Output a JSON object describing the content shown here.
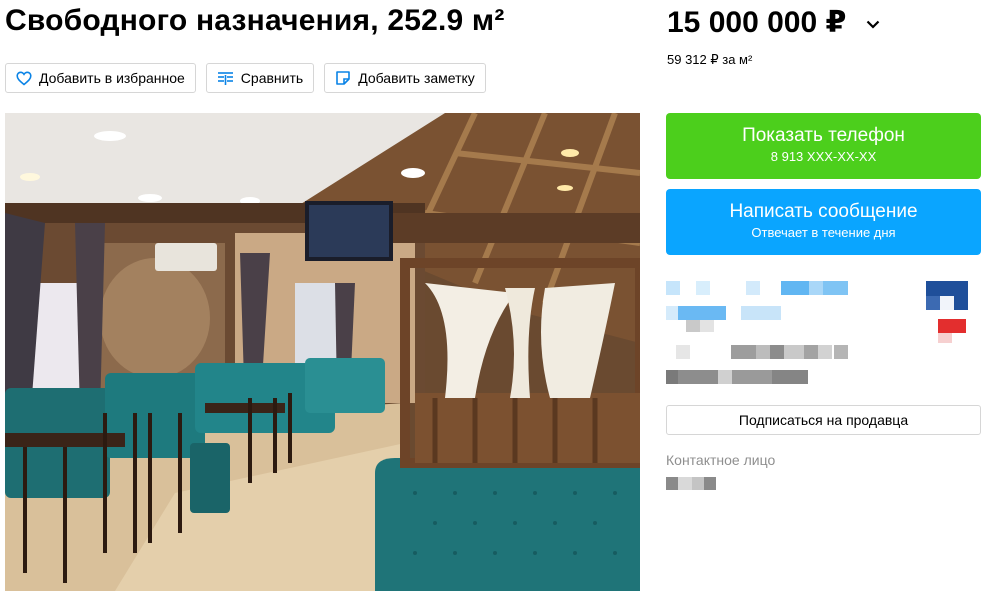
{
  "listing": {
    "title": "Свободного назначения, 252.9 м²",
    "price": "15 000 000 ₽",
    "price_per_m": "59 312 ₽ за м²"
  },
  "actions": {
    "favorite": "Добавить в избранное",
    "compare": "Сравнить",
    "note": "Добавить заметку"
  },
  "contact": {
    "phone_title": "Показать телефон",
    "phone_masked": "8 913 XXX-XX-XX",
    "message_title": "Написать сообщение",
    "message_sub": "Отвечает в течение дня",
    "subscribe": "Подписаться на продавца",
    "contact_person_label": "Контактное лицо"
  },
  "colors": {
    "phone_button": "#4ccf1c",
    "message_button": "#0aa5ff",
    "icon_blue": "#0a83e6"
  },
  "icons": [
    "heart-icon",
    "compare-icon",
    "note-icon",
    "chevron-down-icon"
  ]
}
